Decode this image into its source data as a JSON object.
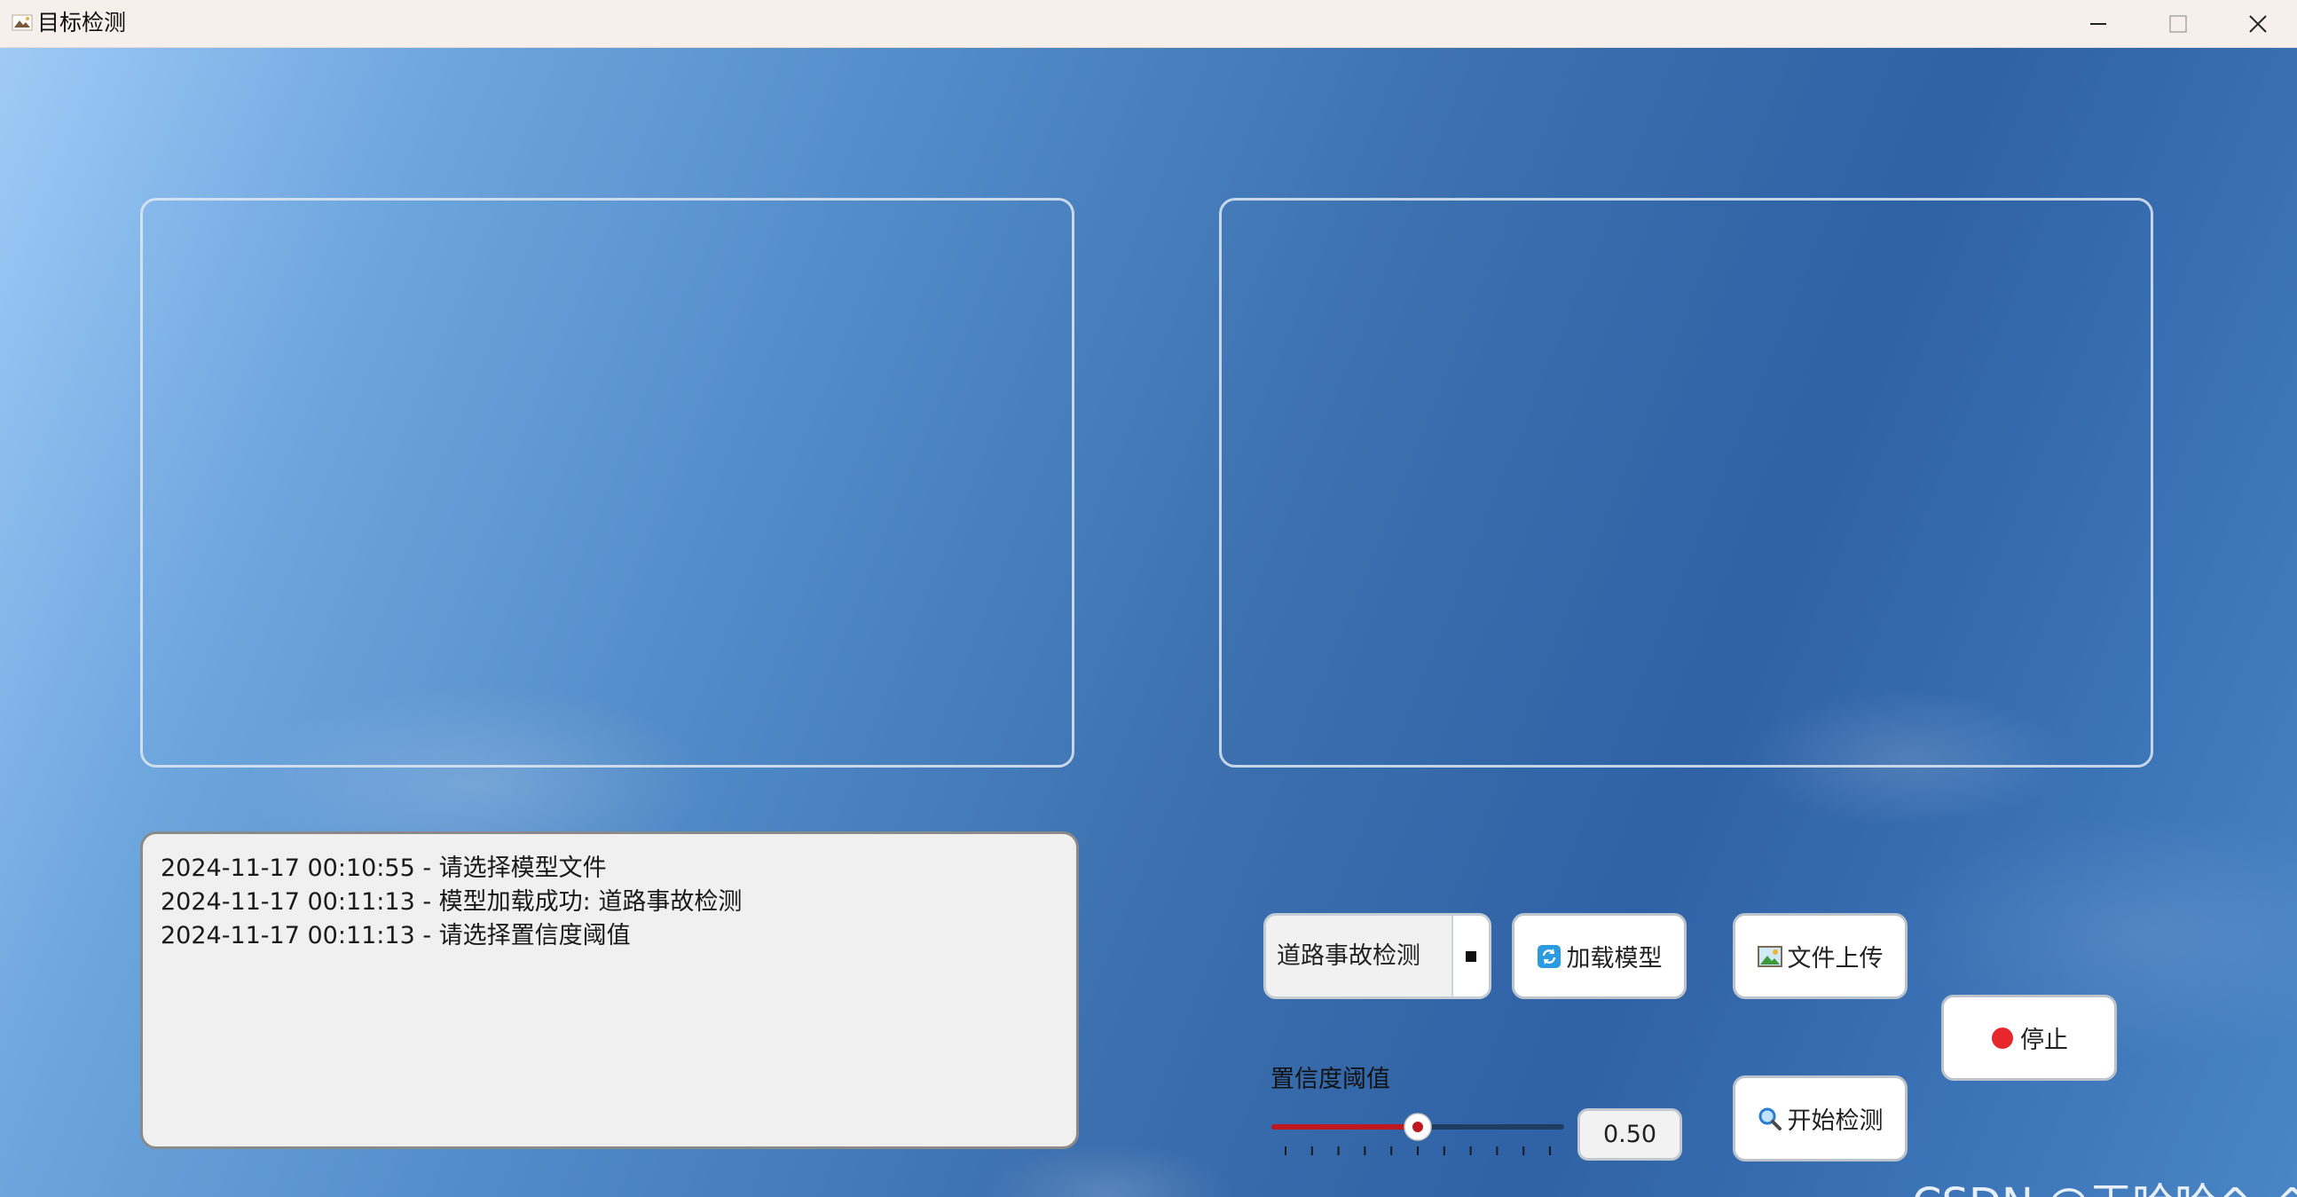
{
  "window": {
    "title": "目标检测",
    "icon": "app-target-icon",
    "controls": [
      "minimize-icon",
      "maximize-icon",
      "close-icon"
    ]
  },
  "log": {
    "lines": [
      "2024-11-17 00:10:55 - 请选择模型文件",
      "2024-11-17 00:11:13 - 模型加载成功: 道路事故检测",
      "2024-11-17 00:11:13 - 请选择置信度阈值"
    ]
  },
  "controls": {
    "model_select": {
      "selected": "道路事故检测"
    },
    "load_model": {
      "label": "加载模型",
      "icon": "refresh-icon"
    },
    "upload_file": {
      "label": "文件上传",
      "icon": "picture-icon"
    },
    "stop": {
      "label": "停止",
      "icon": "red-circle-icon"
    },
    "start_detect": {
      "label": "开始检测",
      "icon": "magnifier-icon"
    },
    "confidence": {
      "label": "置信度阈值",
      "value_text": "0.50",
      "value": 0.5,
      "min": 0,
      "max": 1,
      "tick_count": 11
    }
  },
  "watermark": "CSDN @王哈哈^_^",
  "colors": {
    "slider_filled": "#c0181f",
    "slider_track": "#1f3d63",
    "stop_dot": "#e8262c",
    "titlebar": "#f6efec"
  }
}
